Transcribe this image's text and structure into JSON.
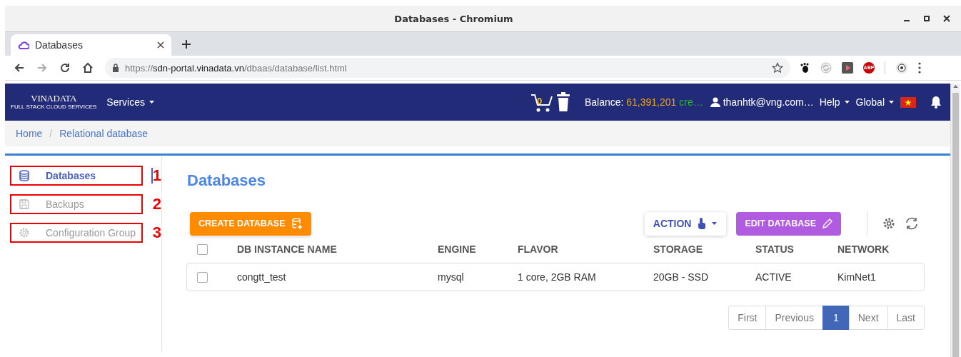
{
  "window": {
    "title": "Databases - Chromium"
  },
  "browser": {
    "tabs": [
      {
        "label": "Databases",
        "selected": true
      }
    ],
    "url": {
      "host": "https://sdn-portal.vinadata.vn",
      "path": "/dbaas/database/list.html"
    },
    "abp_badge": "ABP"
  },
  "navbar": {
    "logo": "VINADATA",
    "tagline": "FULL STACK CLOUD SERVICES",
    "services": "Services",
    "cart_count": "0",
    "balance_label": "Balance:",
    "balance_amount": "61,391,201",
    "balance_unit": "cre…",
    "user": "thanhtk@vng.com…",
    "help": "Help",
    "region": "Global"
  },
  "breadcrumb": {
    "separator": "/",
    "items": [
      {
        "label": "Home"
      },
      {
        "label": "Relational database"
      }
    ]
  },
  "sidebar": {
    "items": [
      {
        "label": "Databases",
        "selected": true,
        "kind": "database",
        "annotation": "1"
      },
      {
        "label": "Backups",
        "selected": false,
        "kind": "backup",
        "annotation": "2"
      },
      {
        "label": "Configuration Group",
        "selected": false,
        "kind": "config",
        "annotation": "3"
      }
    ]
  },
  "page": {
    "title": "Databases",
    "create_button": "CREATE DATABASE",
    "action_button": "ACTION",
    "edit_button": "EDIT DATABASE"
  },
  "table": {
    "all_selected": false,
    "columns": [
      "DB INSTANCE NAME",
      "ENGINE",
      "FLAVOR",
      "STORAGE",
      "STATUS",
      "NETWORK"
    ],
    "rows": [
      {
        "selected": false,
        "cells": [
          "congtt_test",
          "mysql",
          "1 core, 2GB RAM",
          "20GB - SSD",
          "ACTIVE",
          "KimNet1"
        ]
      }
    ]
  },
  "pagination": [
    {
      "label": "First",
      "selected": false
    },
    {
      "label": "Previous",
      "selected": false
    },
    {
      "label": "1",
      "selected": true
    },
    {
      "label": "Next",
      "selected": false
    },
    {
      "label": "Last",
      "selected": false
    }
  ]
}
